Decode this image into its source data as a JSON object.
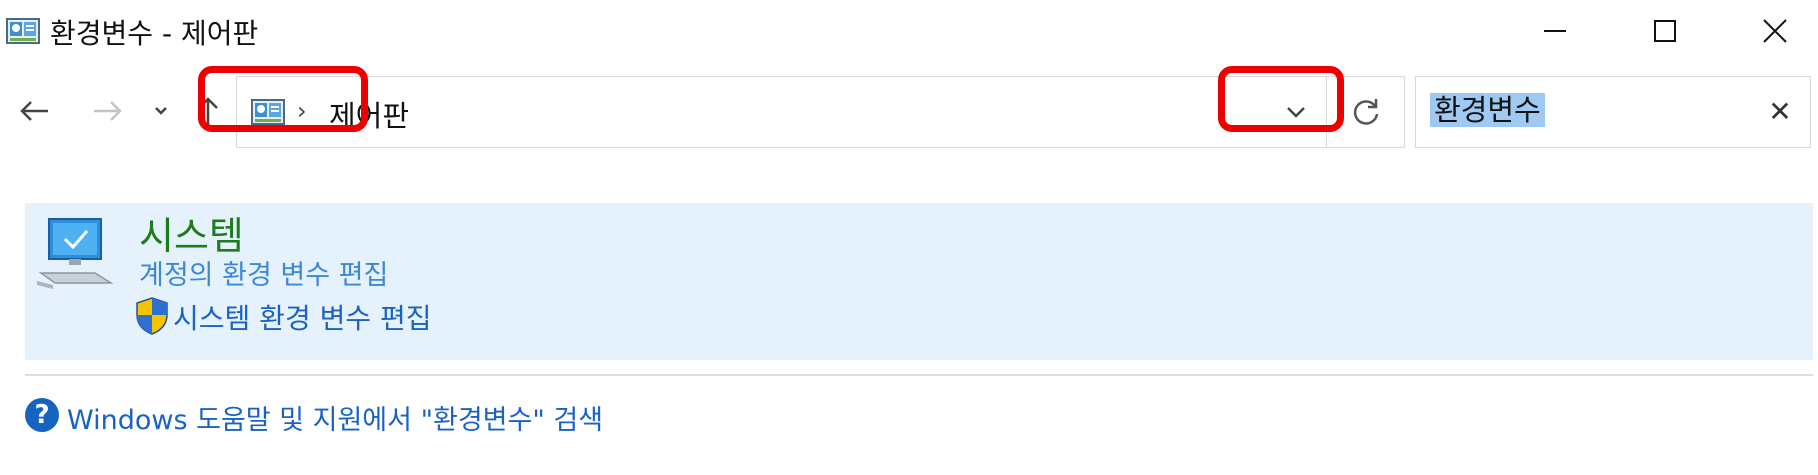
{
  "window": {
    "title": "환경변수 - 제어판"
  },
  "address_bar": {
    "path_item": "제어판",
    "separator": "›"
  },
  "search": {
    "value": "환경변수",
    "clear_glyph": "✕"
  },
  "result": {
    "title": "시스템",
    "link_user_env": "계정의 환경 변수 편집",
    "link_system_env": "시스템 환경 변수 편집"
  },
  "help": {
    "icon_glyph": "?",
    "link": "Windows 도움말 및 지원에서 \"환경변수\" 검색"
  },
  "colors": {
    "highlight": "#ee0000",
    "result_background": "#e5f1fb",
    "title_green": "#1e7b1e",
    "link_blue": "#1a62c4",
    "search_selection": "#9dc9f2"
  }
}
